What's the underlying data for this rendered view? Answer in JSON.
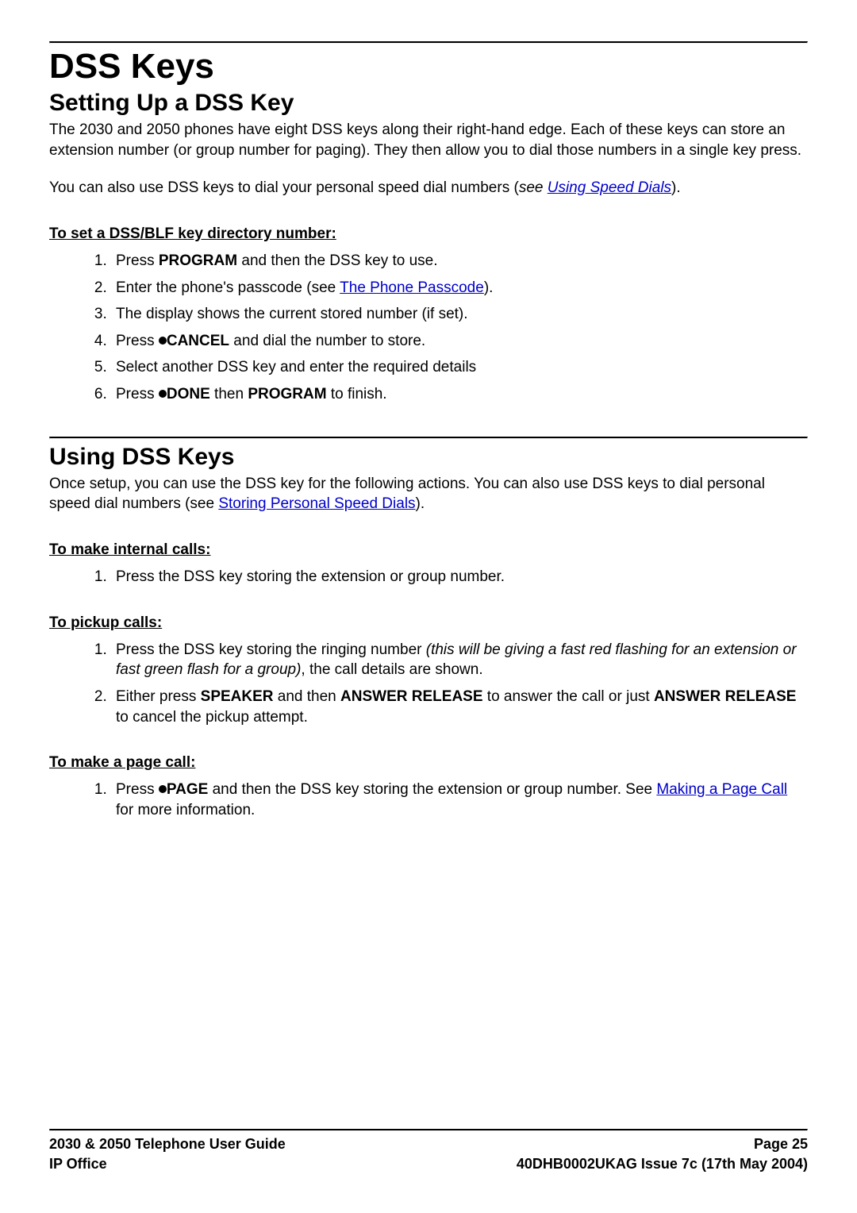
{
  "h1": "DSS Keys",
  "section1": {
    "heading": "Setting Up a DSS Key",
    "p1": "The 2030 and 2050 phones have eight DSS keys along their right-hand edge. Each of these keys can store an extension number (or group number for paging). They then allow you to dial those numbers in a single key press.",
    "p2a": "You can also use DSS keys to dial your personal speed dial numbers (",
    "p2see": "see ",
    "p2link": "Using Speed Dials",
    "p2b": ").",
    "sub1": "To set a DSS/BLF key directory number:",
    "li1a": "Press ",
    "li1b": "PROGRAM",
    "li1c": " and then the DSS key to use.",
    "li2a": "Enter the phone's passcode (see ",
    "li2link": "The Phone Passcode",
    "li2b": ").",
    "li3": "The display shows the current stored number (if set).",
    "li4a": "Press ",
    "li4b": "CANCEL",
    "li4c": " and dial the number to store.",
    "li5": "Select another DSS key and enter the required details",
    "li6a": "Press ",
    "li6b": "DONE",
    "li6c": " then ",
    "li6d": "PROGRAM",
    "li6e": " to finish."
  },
  "section2": {
    "heading": "Using DSS Keys",
    "p1a": "Once setup, you can use the DSS key for the following actions. You can also use DSS keys to dial personal speed dial numbers (see ",
    "p1link": "Storing Personal Speed Dials",
    "p1b": ").",
    "sub1": "To make internal calls:",
    "s1li1": "Press the DSS key storing the extension or group number.",
    "sub2": "To pickup calls:",
    "s2li1a": "Press the DSS key storing the ringing number ",
    "s2li1i": "(this will be giving a fast red flashing for an extension or fast green flash for a group)",
    "s2li1b": ", the call details are shown.",
    "s2li2a": "Either press ",
    "s2li2b": "SPEAKER",
    "s2li2c": " and then ",
    "s2li2d": "ANSWER RELEASE",
    "s2li2e": " to answer the call or just ",
    "s2li2f": "ANSWER RELEASE",
    "s2li2g": " to cancel the pickup attempt.",
    "sub3": "To make a page call:",
    "s3li1a": "Press ",
    "s3li1b": "PAGE",
    "s3li1c": " and then the DSS key storing the extension or group number. See ",
    "s3li1link": "Making a Page Call",
    "s3li1d": " for more information."
  },
  "footer": {
    "left1": "2030 & 2050 Telephone User Guide",
    "right1": "Page 25",
    "left2": "IP Office",
    "right2": "40DHB0002UKAG Issue 7c (17th May 2004)"
  }
}
